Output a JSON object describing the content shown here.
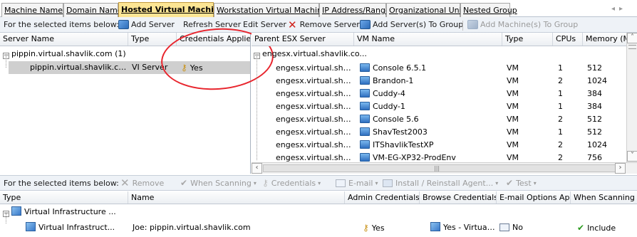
{
  "tabs": [
    {
      "label": "Machine Name",
      "active": false
    },
    {
      "label": "Domain Name",
      "active": false
    },
    {
      "label": "Hosted Virtual Machines",
      "active": true
    },
    {
      "label": "Workstation Virtual Machines",
      "active": false
    },
    {
      "label": "IP Address/Range",
      "active": false
    },
    {
      "label": "Organizational Unit",
      "active": false
    },
    {
      "label": "Nested Group",
      "active": false
    }
  ],
  "top_toolbar": {
    "prompt": "For the selected items below:",
    "add_server": "Add Server",
    "refresh_server": "Refresh Server",
    "edit_server": "Edit Server",
    "remove_server": "Remove Server",
    "add_to_group": "Add Server(s) To Group",
    "add_machines_to_group": "Add Machine(s) To Group"
  },
  "left_grid": {
    "headers": [
      "Server Name",
      "Type",
      "Credentials Applied"
    ],
    "group_label": "pippin.virtual.shavlik.com (1)",
    "row": {
      "name": "pippin.virtual.shavlik.com",
      "type": "VI Server",
      "credentials": "Yes"
    }
  },
  "right_grid": {
    "headers": [
      "Parent ESX Server",
      "VM Name",
      "Type",
      "CPUs",
      "Memory (MB"
    ],
    "group_label": "engesx.virtual.shavlik.co...",
    "rows": [
      {
        "parent": "engesx.virtual.shavli...",
        "vm": "Console 6.5.1",
        "type": "VM",
        "cpus": "1",
        "memory": "512"
      },
      {
        "parent": "engesx.virtual.shavli...",
        "vm": "Brandon-1",
        "type": "VM",
        "cpus": "2",
        "memory": "1024"
      },
      {
        "parent": "engesx.virtual.shavli...",
        "vm": "Cuddy-4",
        "type": "VM",
        "cpus": "1",
        "memory": "384"
      },
      {
        "parent": "engesx.virtual.shavli...",
        "vm": "Cuddy-1",
        "type": "VM",
        "cpus": "1",
        "memory": "384"
      },
      {
        "parent": "engesx.virtual.shavli...",
        "vm": "Console 5.6",
        "type": "VM",
        "cpus": "2",
        "memory": "512"
      },
      {
        "parent": "engesx.virtual.shavli...",
        "vm": "ShavTest2003",
        "type": "VM",
        "cpus": "1",
        "memory": "512"
      },
      {
        "parent": "engesx.virtual.shavli...",
        "vm": "ITShavlikTestXP",
        "type": "VM",
        "cpus": "2",
        "memory": "1024"
      },
      {
        "parent": "engesx.virtual.shavli...",
        "vm": "VM-EG-XP32-ProdEnv",
        "type": "VM",
        "cpus": "2",
        "memory": "756"
      }
    ]
  },
  "bottom_toolbar": {
    "prompt": "For the selected items below:",
    "remove": "Remove",
    "when_scanning": "When Scanning",
    "credentials": "Credentials",
    "email": "E-mail",
    "install": "Install / Reinstall Agent...",
    "test": "Test"
  },
  "bottom_grid": {
    "headers": [
      "Type",
      "Name",
      "Admin Credentials",
      "Browse Credentials",
      "E-mail Options Ap...",
      "When Scanning"
    ],
    "group_label": "Virtual Infrastructure ...",
    "row": {
      "type": "Virtual Infrastruct...",
      "name": "Joe: pippin.virtual.shavlik.com",
      "admin": "Yes",
      "browse": "Yes - Virtual S...",
      "email": "No",
      "scanning": "Include"
    }
  },
  "colors": {
    "active_tab": "#fde594",
    "selection": "#cfcfcf",
    "annotation": "#e8252d"
  }
}
